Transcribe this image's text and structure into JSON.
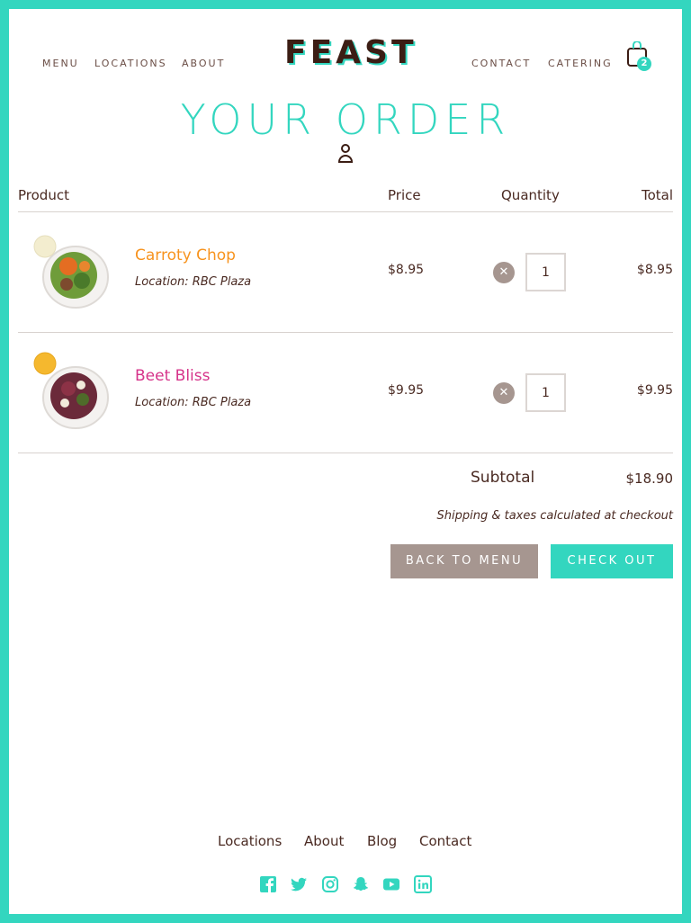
{
  "header": {
    "logo": "FEAST",
    "nav_left": [
      "MENU",
      "LOCATIONS",
      "ABOUT"
    ],
    "nav_right": [
      "CONTACT",
      "CATERING"
    ],
    "cart_count": "2"
  },
  "page_title": "YOUR ORDER",
  "table": {
    "headers": {
      "product": "Product",
      "price": "Price",
      "quantity": "Quantity",
      "total": "Total"
    },
    "items": [
      {
        "name": "Carroty Chop",
        "name_color": "#f7931e",
        "location": "Location: RBC Plaza",
        "price": "$8.95",
        "quantity": "1",
        "total": "$8.95",
        "dressing_color": "#f3edcf"
      },
      {
        "name": "Beet Bliss",
        "name_color": "#d6338a",
        "location": "Location: RBC Plaza",
        "price": "$9.95",
        "quantity": "1",
        "total": "$9.95",
        "dressing_color": "#f5b82e"
      }
    ]
  },
  "summary": {
    "subtotal_label": "Subtotal",
    "subtotal_value": "$18.90",
    "shipping_note": "Shipping & taxes calculated at checkout"
  },
  "actions": {
    "back_label": "BACK TO MENU",
    "checkout_label": "CHECK OUT"
  },
  "footer": {
    "links": [
      "Locations",
      "About",
      "Blog",
      "Contact"
    ],
    "social_icons": [
      "facebook-icon",
      "twitter-icon",
      "instagram-icon",
      "snapchat-icon",
      "youtube-icon",
      "linkedin-icon"
    ]
  },
  "colors": {
    "accent": "#33d6bf",
    "brown": "#4a2a22",
    "muted_button": "#a69690"
  }
}
